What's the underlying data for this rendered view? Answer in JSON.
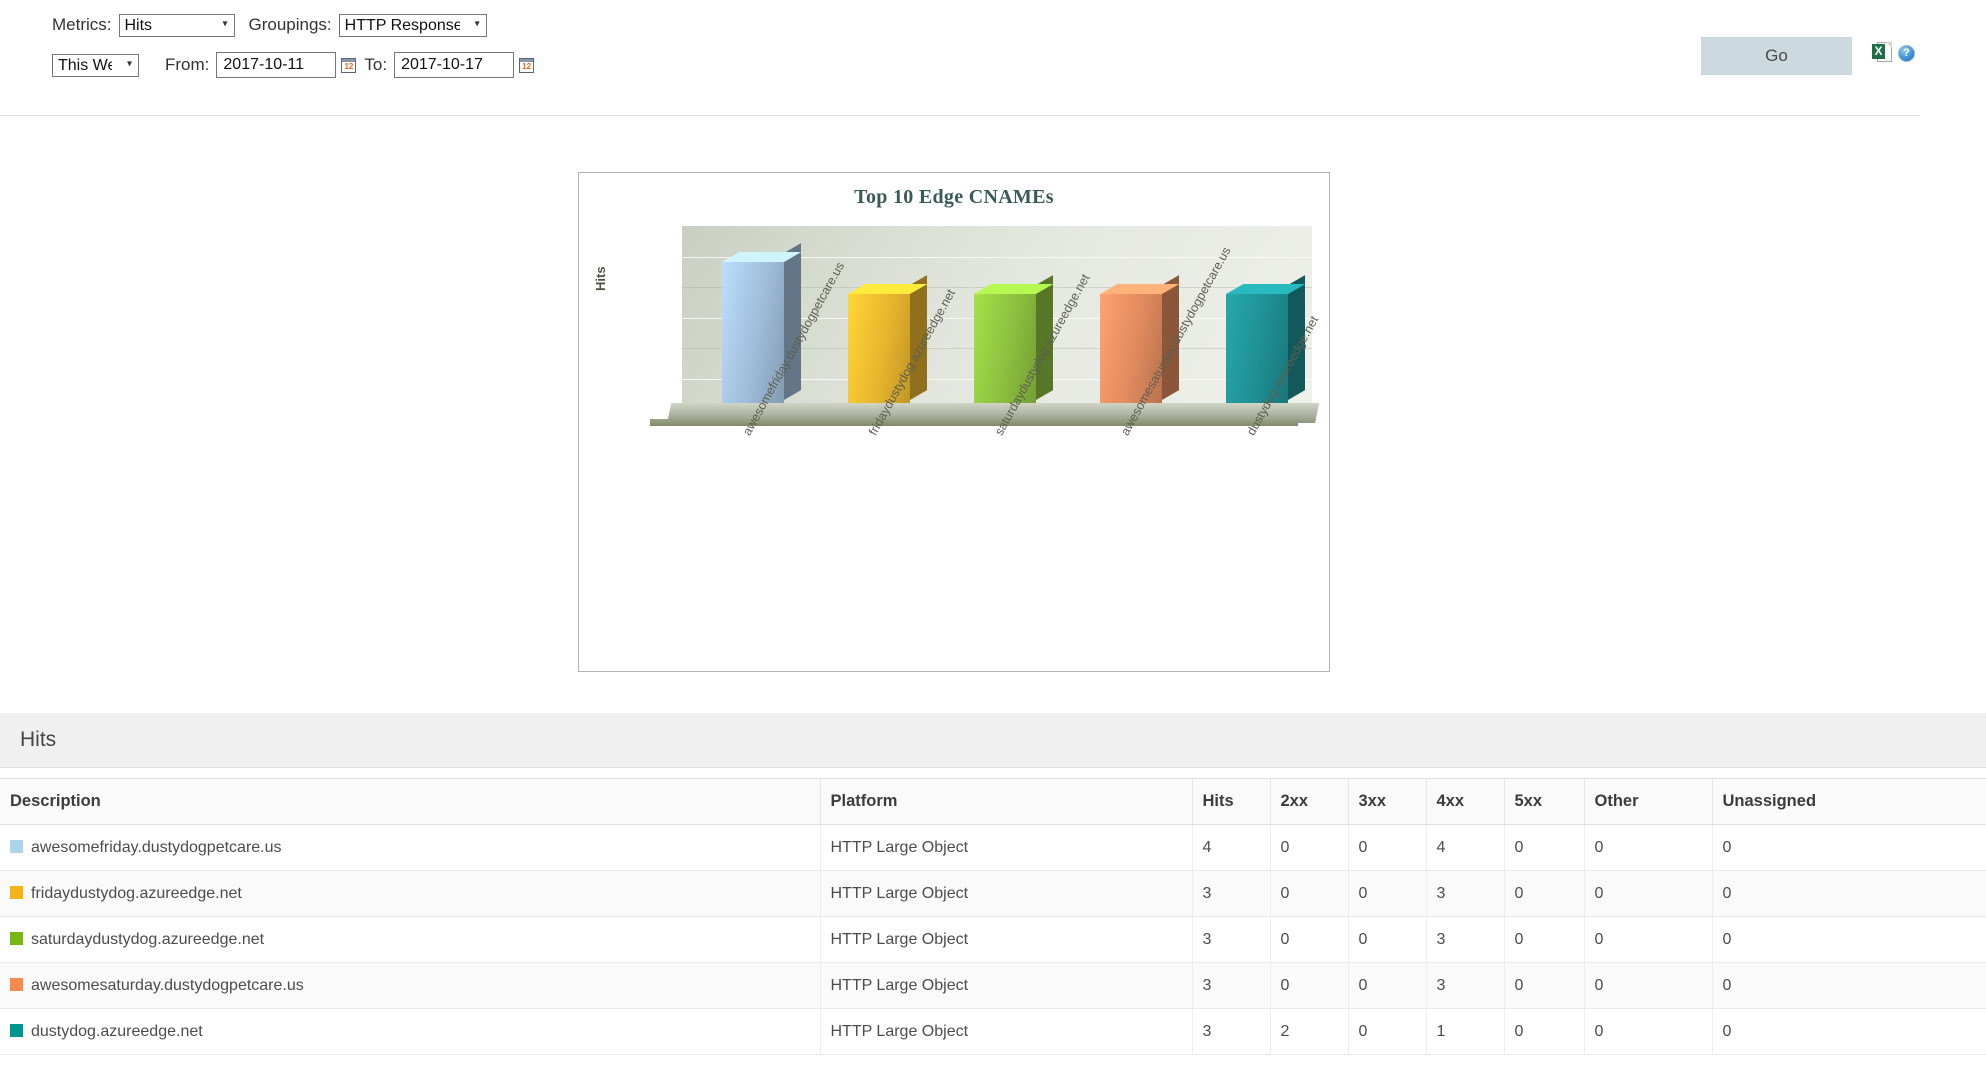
{
  "toolbar": {
    "metrics_label": "Metrics:",
    "metrics_value": "Hits",
    "groupings_label": "Groupings:",
    "groupings_value": "HTTP Response Codes",
    "range_value": "This Week",
    "from_label": "From:",
    "from_value": "2017-10-11",
    "to_label": "To:",
    "to_value": "2017-10-17",
    "go_label": "Go",
    "calendar_icon": "calendar-icon",
    "excel_icon": "excel-export-icon",
    "excel_glyph": "X",
    "help_icon": "help-icon",
    "help_glyph": "?",
    "cal_glyph": "12",
    "dropdown_arrow": "chevron-down-icon",
    "arrow_glyph": "⌄"
  },
  "chart_data": {
    "type": "bar",
    "title": "Top 10 Edge CNAMEs",
    "xlabel": "",
    "ylabel": "Hits",
    "ylim": [
      0,
      5
    ],
    "grid": true,
    "legend": "none",
    "categories": [
      "awesomefriday.dustydogpetcare.us",
      "fridaydustydog.azureedge.net",
      "saturdaydustydog.azureedge.net",
      "awesomesaturday.dustydogpetcare.us",
      "dustydog.azureedge.net"
    ],
    "values": [
      4,
      3,
      3,
      3,
      3
    ],
    "colors": [
      "#9fbcd8",
      "#e8b52e",
      "#8cbf3f",
      "#e08a5e",
      "#1f8f93"
    ]
  },
  "section": {
    "title": "Hits"
  },
  "table": {
    "columns": [
      "Description",
      "Platform",
      "Hits",
      "2xx",
      "3xx",
      "4xx",
      "5xx",
      "Other",
      "Unassigned"
    ],
    "rows": [
      {
        "swatch": "#aed3ec",
        "description": "awesomefriday.dustydogpetcare.us",
        "platform": "HTTP Large Object",
        "hits": "4",
        "c2xx": "0",
        "c3xx": "0",
        "c4xx": "4",
        "c5xx": "0",
        "other": "0",
        "unassigned": "0"
      },
      {
        "swatch": "#f5b31a",
        "description": "fridaydustydog.azureedge.net",
        "platform": "HTTP Large Object",
        "hits": "3",
        "c2xx": "0",
        "c3xx": "0",
        "c4xx": "3",
        "c5xx": "0",
        "other": "0",
        "unassigned": "0"
      },
      {
        "swatch": "#77b713",
        "description": "saturdaydustydog.azureedge.net",
        "platform": "HTTP Large Object",
        "hits": "3",
        "c2xx": "0",
        "c3xx": "0",
        "c4xx": "3",
        "c5xx": "0",
        "other": "0",
        "unassigned": "0"
      },
      {
        "swatch": "#f68a4f",
        "description": "awesomesaturday.dustydogpetcare.us",
        "platform": "HTTP Large Object",
        "hits": "3",
        "c2xx": "0",
        "c3xx": "0",
        "c4xx": "3",
        "c5xx": "0",
        "other": "0",
        "unassigned": "0"
      },
      {
        "swatch": "#00968f",
        "description": "dustydog.azureedge.net",
        "platform": "HTTP Large Object",
        "hits": "3",
        "c2xx": "2",
        "c3xx": "0",
        "c4xx": "1",
        "c5xx": "0",
        "other": "0",
        "unassigned": "0"
      }
    ]
  }
}
